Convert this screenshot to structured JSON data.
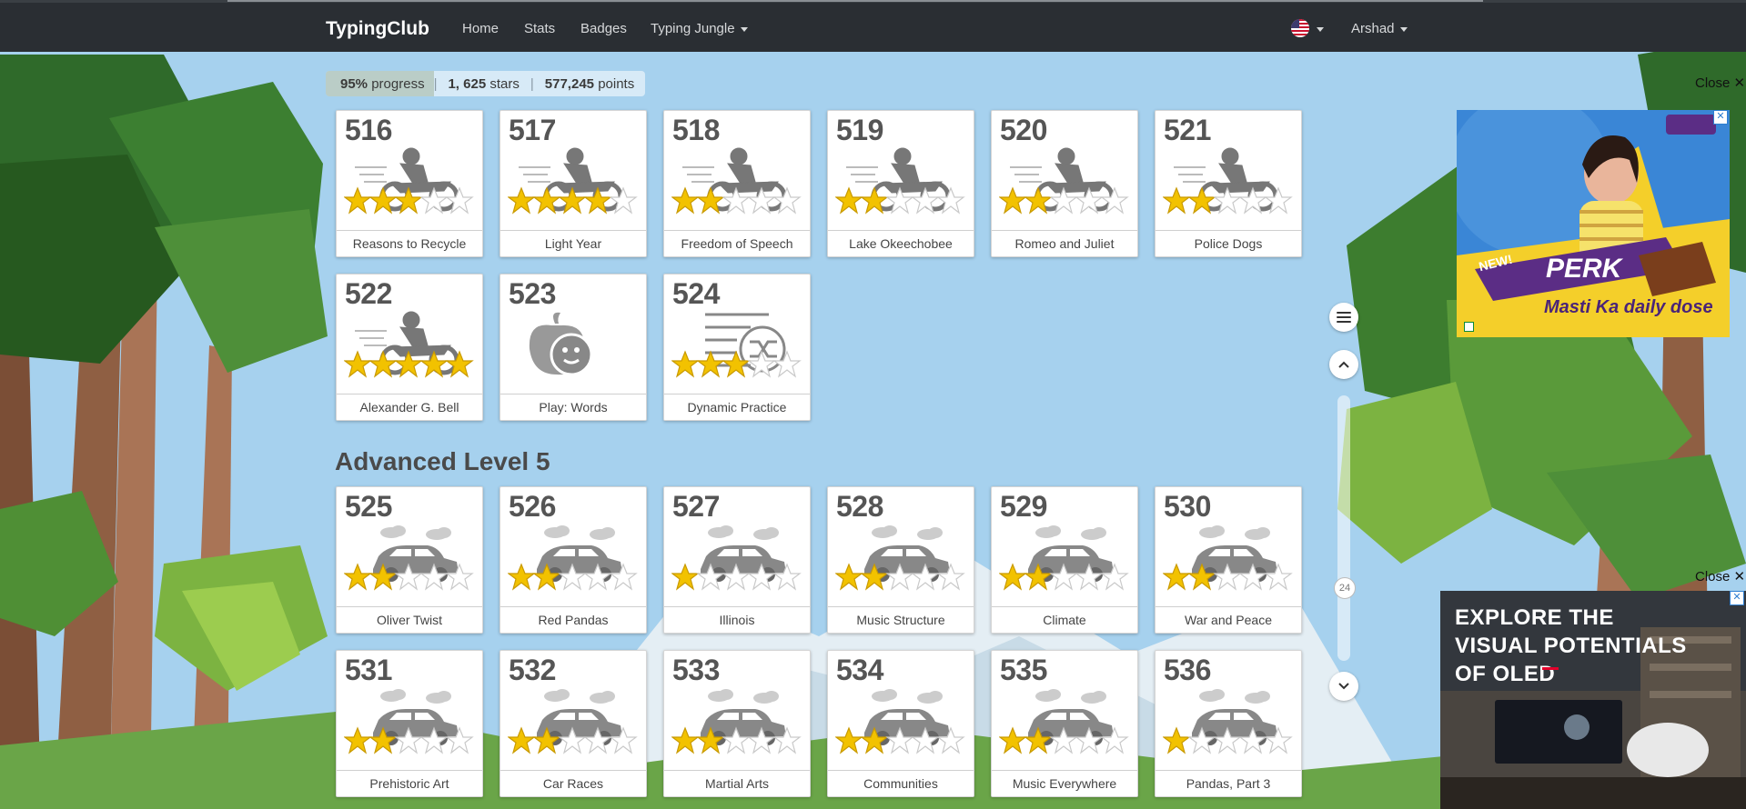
{
  "nav": {
    "brand": "TypingClub",
    "links": [
      "Home",
      "Stats",
      "Badges",
      "Typing Jungle"
    ],
    "user": "Arshad"
  },
  "progress": {
    "percent": "95%",
    "percent_label": "progress",
    "stars": "1, 625",
    "stars_label": "stars",
    "points": "577,245",
    "points_label": "points"
  },
  "lessons_top": [
    {
      "num": "516",
      "name": "Reasons to Recycle",
      "icon": "motorcycle-icon",
      "stars": 3
    },
    {
      "num": "517",
      "name": "Light Year",
      "icon": "motorcycle-icon",
      "stars": 4
    },
    {
      "num": "518",
      "name": "Freedom of Speech",
      "icon": "motorcycle-icon",
      "stars": 2
    },
    {
      "num": "519",
      "name": "Lake Okeechobee",
      "icon": "motorcycle-icon",
      "stars": 2
    },
    {
      "num": "520",
      "name": "Romeo and Juliet",
      "icon": "motorcycle-icon",
      "stars": 2
    },
    {
      "num": "521",
      "name": "Police Dogs",
      "icon": "motorcycle-icon",
      "stars": 2
    },
    {
      "num": "522",
      "name": "Alexander G. Bell",
      "icon": "motorcycle-icon",
      "stars": 5
    },
    {
      "num": "523",
      "name": "Play: Words",
      "icon": "game-icon",
      "stars": 0
    },
    {
      "num": "524",
      "name": "Dynamic Practice",
      "icon": "shuffle-list-icon",
      "stars": 3
    }
  ],
  "section": {
    "title": "Advanced Level 5"
  },
  "lessons_advanced": [
    {
      "num": "525",
      "name": "Oliver Twist",
      "icon": "car-icon",
      "stars": 2
    },
    {
      "num": "526",
      "name": "Red Pandas",
      "icon": "car-icon",
      "stars": 2
    },
    {
      "num": "527",
      "name": "Illinois",
      "icon": "car-icon",
      "stars": 1
    },
    {
      "num": "528",
      "name": "Music Structure",
      "icon": "car-icon",
      "stars": 2
    },
    {
      "num": "529",
      "name": "Climate",
      "icon": "car-icon",
      "stars": 2
    },
    {
      "num": "530",
      "name": "War and Peace",
      "icon": "car-icon",
      "stars": 2
    },
    {
      "num": "531",
      "name": "Prehistoric Art",
      "icon": "car-icon",
      "stars": 2
    },
    {
      "num": "532",
      "name": "Car Races",
      "icon": "car-icon",
      "stars": 2
    },
    {
      "num": "533",
      "name": "Martial Arts",
      "icon": "car-icon",
      "stars": 2
    },
    {
      "num": "534",
      "name": "Communities",
      "icon": "car-icon",
      "stars": 2
    },
    {
      "num": "535",
      "name": "Music Everywhere",
      "icon": "car-icon",
      "stars": 2
    },
    {
      "num": "536",
      "name": "Pandas, Part 3",
      "icon": "car-icon",
      "stars": 1
    }
  ],
  "scroll": {
    "badge": "24"
  },
  "ads": {
    "close_label": "Close",
    "ad1_brand": "PERK",
    "ad1_tagline": "Masti Ka daily dose",
    "ad1_new": "NEW!",
    "ad2_headline_line1": "EXPLORE THE",
    "ad2_headline_line2": "VISUAL POTENTIALS",
    "ad2_headline_line3": "OF OLED"
  },
  "colors": {
    "nav_bg": "#2a2e33",
    "star": "#f2c200",
    "accent": "#2f7fd1"
  }
}
